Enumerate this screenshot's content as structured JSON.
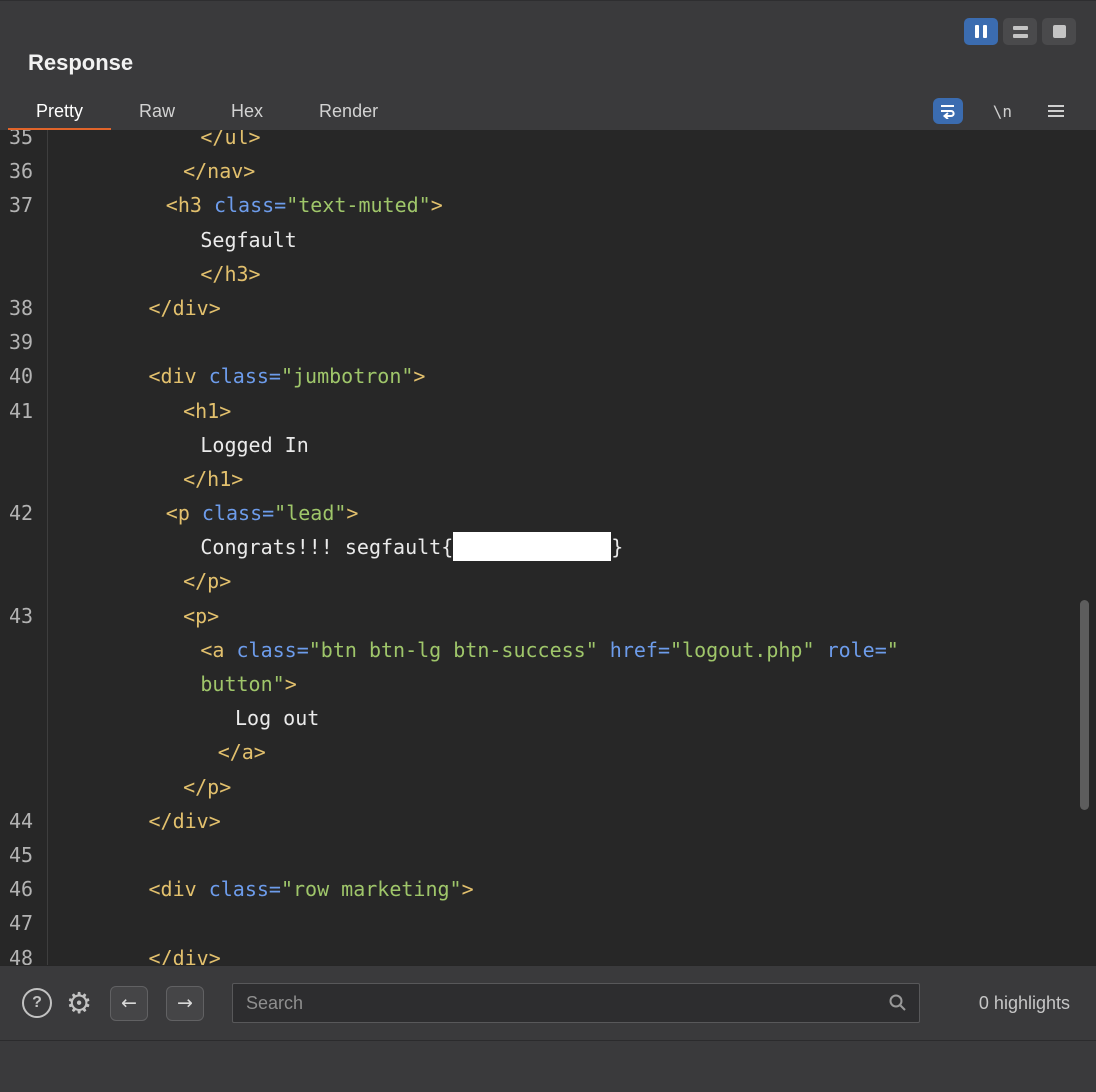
{
  "header": {
    "title": "Response",
    "tabs": [
      {
        "label": "Pretty",
        "active": true
      },
      {
        "label": "Raw",
        "active": false
      },
      {
        "label": "Hex",
        "active": false
      },
      {
        "label": "Render",
        "active": false
      }
    ],
    "newline_toggle": "\\n"
  },
  "icons": {
    "help": "?",
    "settings": "⚙",
    "back": "←",
    "forward": "→"
  },
  "colors": {
    "accent_orange": "#e0642a",
    "accent_blue": "#3b6cb0",
    "code_background": "#272727",
    "chrome_background": "#3a3a3c",
    "syntax_tag": "#e2c06d",
    "syntax_attribute": "#6d9ceb",
    "syntax_value": "#9fc66a",
    "syntax_text": "#eaeaea",
    "redaction": "#ffffff"
  },
  "editor": {
    "rows": [
      {
        "num": "35",
        "ind": 8,
        "segs": [
          {
            "c": "tag",
            "t": "</ul>"
          }
        ]
      },
      {
        "num": "36",
        "ind": 7,
        "segs": [
          {
            "c": "tag",
            "t": "</nav>"
          }
        ]
      },
      {
        "num": "37",
        "ind": 6,
        "segs": [
          {
            "c": "tag",
            "t": "<h3 "
          },
          {
            "c": "attr",
            "t": "class="
          },
          {
            "c": "val",
            "t": "\"text-muted\""
          },
          {
            "c": "tag",
            "t": ">"
          }
        ]
      },
      {
        "num": "",
        "ind": 8,
        "segs": [
          {
            "c": "text",
            "t": "Segfault"
          }
        ]
      },
      {
        "num": "",
        "ind": 8,
        "segs": [
          {
            "c": "tag",
            "t": "</h3>"
          }
        ]
      },
      {
        "num": "38",
        "ind": 5,
        "segs": [
          {
            "c": "tag",
            "t": "</div>"
          }
        ]
      },
      {
        "num": "39",
        "ind": 0,
        "segs": []
      },
      {
        "num": "40",
        "ind": 5,
        "segs": [
          {
            "c": "tag",
            "t": "<div "
          },
          {
            "c": "attr",
            "t": "class="
          },
          {
            "c": "val",
            "t": "\"jumbotron\""
          },
          {
            "c": "tag",
            "t": ">"
          }
        ]
      },
      {
        "num": "41",
        "ind": 7,
        "segs": [
          {
            "c": "tag",
            "t": "<h1>"
          }
        ]
      },
      {
        "num": "",
        "ind": 8,
        "segs": [
          {
            "c": "text",
            "t": "Logged In"
          }
        ]
      },
      {
        "num": "",
        "ind": 7,
        "segs": [
          {
            "c": "tag",
            "t": "</h1>"
          }
        ]
      },
      {
        "num": "42",
        "ind": 6,
        "segs": [
          {
            "c": "tag",
            "t": "<p "
          },
          {
            "c": "attr",
            "t": "class="
          },
          {
            "c": "val",
            "t": "\"lead\""
          },
          {
            "c": "tag",
            "t": ">"
          }
        ]
      },
      {
        "num": "",
        "ind": 8,
        "segs": [
          {
            "c": "text",
            "t": "Congrats!!! segfault{"
          },
          {
            "c": "redact",
            "t": ""
          },
          {
            "c": "text",
            "t": "}"
          }
        ]
      },
      {
        "num": "",
        "ind": 7,
        "segs": [
          {
            "c": "tag",
            "t": "</p>"
          }
        ]
      },
      {
        "num": "43",
        "ind": 7,
        "segs": [
          {
            "c": "tag",
            "t": "<p>"
          }
        ]
      },
      {
        "num": "",
        "ind": 8,
        "segs": [
          {
            "c": "tag",
            "t": "<a "
          },
          {
            "c": "attr",
            "t": "class="
          },
          {
            "c": "val",
            "t": "\"btn btn-lg btn-success\" "
          },
          {
            "c": "attr",
            "t": "href="
          },
          {
            "c": "val",
            "t": "\"logout.php\" "
          },
          {
            "c": "attr",
            "t": "role="
          },
          {
            "c": "val",
            "t": "\""
          }
        ]
      },
      {
        "num": "",
        "ind": 8,
        "segs": [
          {
            "c": "val",
            "t": "button\""
          },
          {
            "c": "tag",
            "t": ">"
          }
        ]
      },
      {
        "num": "",
        "ind": 10,
        "segs": [
          {
            "c": "text",
            "t": "Log out"
          }
        ]
      },
      {
        "num": "",
        "ind": 9,
        "segs": [
          {
            "c": "tag",
            "t": "</a>"
          }
        ]
      },
      {
        "num": "",
        "ind": 7,
        "segs": [
          {
            "c": "tag",
            "t": "</p>"
          }
        ]
      },
      {
        "num": "44",
        "ind": 5,
        "segs": [
          {
            "c": "tag",
            "t": "</div>"
          }
        ]
      },
      {
        "num": "45",
        "ind": 0,
        "segs": []
      },
      {
        "num": "46",
        "ind": 5,
        "segs": [
          {
            "c": "tag",
            "t": "<div "
          },
          {
            "c": "attr",
            "t": "class="
          },
          {
            "c": "val",
            "t": "\"row marketing\""
          },
          {
            "c": "tag",
            "t": ">"
          }
        ]
      },
      {
        "num": "47",
        "ind": 0,
        "segs": []
      },
      {
        "num": "48",
        "ind": 5,
        "segs": [
          {
            "c": "tag",
            "t": "</div>"
          }
        ]
      }
    ]
  },
  "footer": {
    "search": {
      "placeholder": "Search",
      "value": ""
    },
    "highlights": "0 highlights"
  }
}
